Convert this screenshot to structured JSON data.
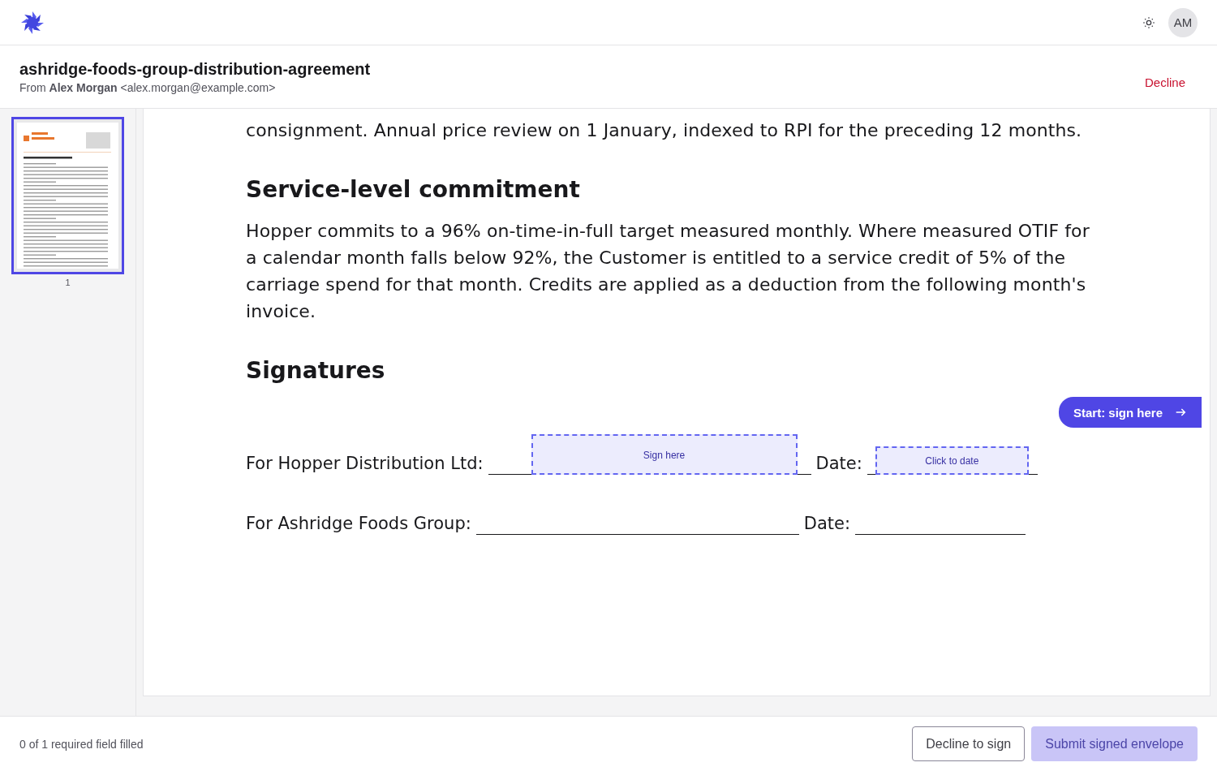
{
  "topbar": {
    "avatar": "AM"
  },
  "envelope": {
    "title": "ashridge-foods-group-distribution-agreement",
    "from_label": "From",
    "sender_name": "Alex Morgan",
    "sender_email": "<alex.morgan@example.com>",
    "decline": "Decline"
  },
  "pages": [
    {
      "number": "1",
      "selected": true
    }
  ],
  "document": {
    "blocks": [
      {
        "kind": "paragraph",
        "text": "consignment. Annual price review on 1 January, indexed to RPI for the preceding 12 months."
      },
      {
        "kind": "heading",
        "text": "Service-level commitment"
      },
      {
        "kind": "paragraph",
        "text": "Hopper commits to a 96% on-time-in-full target measured monthly. Where measured OTIF for a calendar month falls below 92%, the Customer is entitled to a service credit of 5% of the carriage spend for that month. Credits are applied as a deduction from the following month's invoice."
      },
      {
        "kind": "heading",
        "text": "Signatures"
      }
    ],
    "signature_rows": [
      {
        "party": "For Hopper Distribution Ltd:",
        "date_label": "Date:",
        "signature_field": "Sign here",
        "date_field": "Click to date"
      },
      {
        "party": "For Ashridge Foods Group:",
        "date_label": "Date:"
      }
    ],
    "start_button": "Start: sign here"
  },
  "footer": {
    "status": "0 of 1 required field filled",
    "decline_button": "Decline to sign",
    "submit_button": "Submit signed envelope",
    "submit_disabled": true
  }
}
